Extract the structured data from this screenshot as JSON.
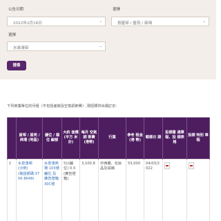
{
  "filters": {
    "date_label": "公告日期",
    "date_value": "2022年2月18日",
    "type_label": "選擇",
    "type_value": "按屋邨 / 屋苑 / 商場",
    "estate_label": "選擇",
    "estate_value": "水泉澳邨",
    "search_label": "搜尋"
  },
  "note": "下列商業單位的月租（不包括差餉及空氣調節費）,現招標供出價訂定：",
  "table": {
    "headers": [
      "",
      "屋邨 / 屋苑 / 商場 (地區)",
      "舖位 / 檔位 編號",
      "大約 面積 (平方 米計)",
      "每月 空氣調 節費 (港幣)",
      "行業",
      "參考 租金 (港 幣)",
      "截標日 期",
      "投標書 通單 程、投 標表格",
      "投標 特別 章程"
    ],
    "row": {
      "index": "1",
      "estate_name": "水泉澳邨",
      "estate_district": "(沙田)",
      "estate_tel": "(電話號碼:3700 8649)",
      "shop_no": "水泉澳商場 103號舖位 及 廣告燈箱 30C號",
      "area": "51(舖位) 0.3(廣告燈箱)",
      "ac_fee": "3,100.8",
      "trade": "中西藥、化妝品及滋補",
      "rent": "53,000",
      "closing_date": "04/03/2022"
    }
  }
}
